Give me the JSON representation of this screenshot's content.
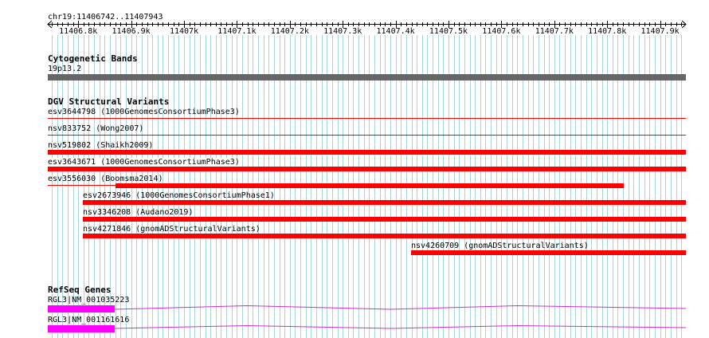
{
  "ruler": {
    "region": "chr19:11406742..11407943",
    "ticks": [
      "11406.8k",
      "11406.9k",
      "11407k",
      "11407.1k",
      "11407.2k",
      "11407.3k",
      "11407.4k",
      "11407.5k",
      "11407.6k",
      "11407.7k",
      "11407.8k",
      "11407.9k"
    ]
  },
  "cytoband": {
    "title": "Cytogenetic Bands",
    "band": "19p13.2",
    "color": "#666666"
  },
  "dgv": {
    "title": "DGV Structural Variants",
    "color": "#ff0000",
    "items": [
      {
        "label": "esv3644798 (1000GenomesConsortiumPhase3)"
      },
      {
        "label": "nsv833752 (Wong2007)"
      },
      {
        "label": "nsv519802 (Shaikh2009)"
      },
      {
        "label": "esv3643671 (1000GenomesConsortiumPhase3)"
      },
      {
        "label": "esv3556030 (Boomsma2014)"
      },
      {
        "label": "esv2673946 (1000GenomesConsortiumPhase1)"
      },
      {
        "label": "nsv3346208 (Audano2019)"
      },
      {
        "label": "nsv4271846 (gnomADStructuralVariants)"
      },
      {
        "label": "nsv4260709 (gnomADStructuralVariants)"
      }
    ]
  },
  "refseq": {
    "title": "RefSeq Genes",
    "color": "#ff00ff",
    "items": [
      {
        "label": "RGL3|NM_001035223"
      },
      {
        "label": "RGL3|NM_001161616"
      }
    ]
  }
}
